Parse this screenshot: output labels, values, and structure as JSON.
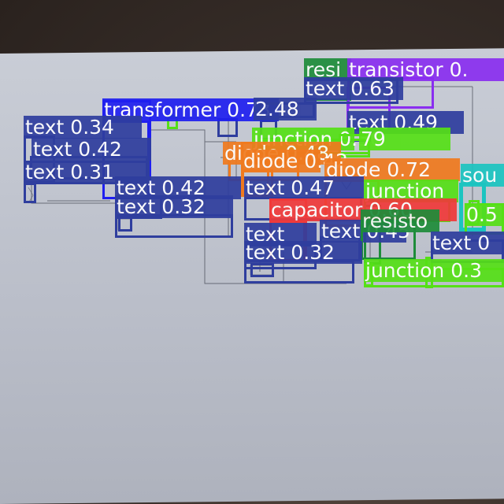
{
  "colors": {
    "text": "#2f3e9e",
    "transformer": "#1f1ff0",
    "resistor": "#1e8c3a",
    "transistor": "#8a2ef0",
    "junction": "#55e016",
    "diode": "#f07a1e",
    "capacitor": "#f03a3a",
    "source": "#1bc4c0"
  },
  "detections": [
    {
      "label": "resi",
      "cls": "resistor"
    },
    {
      "label": "transistor 0.",
      "cls": "transistor"
    },
    {
      "label": "text 0.63",
      "cls": "text"
    },
    {
      "label": "transformer 0.73",
      "cls": "transformer"
    },
    {
      "label": "2.48",
      "cls": "text"
    },
    {
      "label": "text 0.34",
      "cls": "text"
    },
    {
      "label": "text 0.49",
      "cls": "text"
    },
    {
      "label": "junction 0.30",
      "cls": "junction"
    },
    {
      "label": "79",
      "cls": "junction"
    },
    {
      "label": "text 0.42",
      "cls": "text"
    },
    {
      "label": "diode 0.48",
      "cls": "diode"
    },
    {
      "label": "diode 0.42",
      "cls": "diode"
    },
    {
      "label": "diode 0.72",
      "cls": "diode"
    },
    {
      "label": "text 0.31",
      "cls": "text"
    },
    {
      "label": "text 0.42",
      "cls": "text"
    },
    {
      "label": "text 0.47",
      "cls": "text"
    },
    {
      "label": "junction",
      "cls": "junction"
    },
    {
      "label": "sou",
      "cls": "source"
    },
    {
      "label": "text 0.32",
      "cls": "text"
    },
    {
      "label": "capacitor 0.60",
      "cls": "capacitor"
    },
    {
      "label": "text",
      "cls": "text"
    },
    {
      "label": "text 0.45",
      "cls": "text"
    },
    {
      "label": "resisto",
      "cls": "resistor"
    },
    {
      "label": "0.5",
      "cls": "junction"
    },
    {
      "label": "text 0.32",
      "cls": "text"
    },
    {
      "label": "text 0",
      "cls": "text"
    },
    {
      "label": "junction 0.3",
      "cls": "junction"
    }
  ],
  "boxes_only": [
    {
      "cls": "transformer"
    },
    {
      "cls": "text"
    },
    {
      "cls": "capacitor"
    },
    {
      "cls": "resistor"
    },
    {
      "cls": "diode"
    },
    {
      "cls": "source"
    },
    {
      "cls": "junction"
    },
    {
      "cls": "junction"
    },
    {
      "cls": "junction"
    },
    {
      "cls": "junction"
    },
    {
      "cls": "text"
    },
    {
      "cls": "text"
    },
    {
      "cls": "text"
    },
    {
      "cls": "text"
    },
    {
      "cls": "transistor"
    }
  ]
}
